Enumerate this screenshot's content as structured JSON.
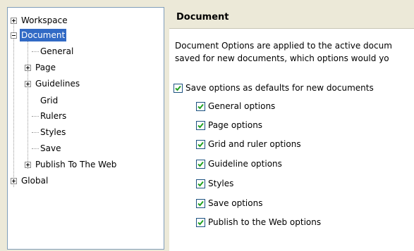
{
  "tree": {
    "items": [
      {
        "label": "Workspace",
        "expander": "plus"
      },
      {
        "label": "Document",
        "expander": "minus",
        "selected": true
      },
      {
        "label": "General"
      },
      {
        "label": "Page",
        "expander": "plus"
      },
      {
        "label": "Guidelines",
        "expander": "plus"
      },
      {
        "label": "Grid"
      },
      {
        "label": "Rulers"
      },
      {
        "label": "Styles"
      },
      {
        "label": "Save"
      },
      {
        "label": "Publish To The Web",
        "expander": "plus"
      },
      {
        "label": "Global",
        "expander": "plus"
      }
    ]
  },
  "panel": {
    "title": "Document",
    "description_line1": "Document Options are applied to the active docum",
    "description_line2": "saved for new documents, which options would yo",
    "main_option": {
      "label": "Save options as defaults for new documents",
      "checked": true
    },
    "options": [
      {
        "label": "General options",
        "checked": true
      },
      {
        "label": "Page options",
        "checked": true
      },
      {
        "label": "Grid and ruler options",
        "checked": true
      },
      {
        "label": "Guideline options",
        "checked": true
      },
      {
        "label": "Styles",
        "checked": true
      },
      {
        "label": "Save options",
        "checked": true
      },
      {
        "label": "Publish to the Web options",
        "checked": true
      }
    ]
  },
  "colors": {
    "selection": "#316ac5",
    "check": "#21a121",
    "header_bg": "#ece9d8"
  }
}
